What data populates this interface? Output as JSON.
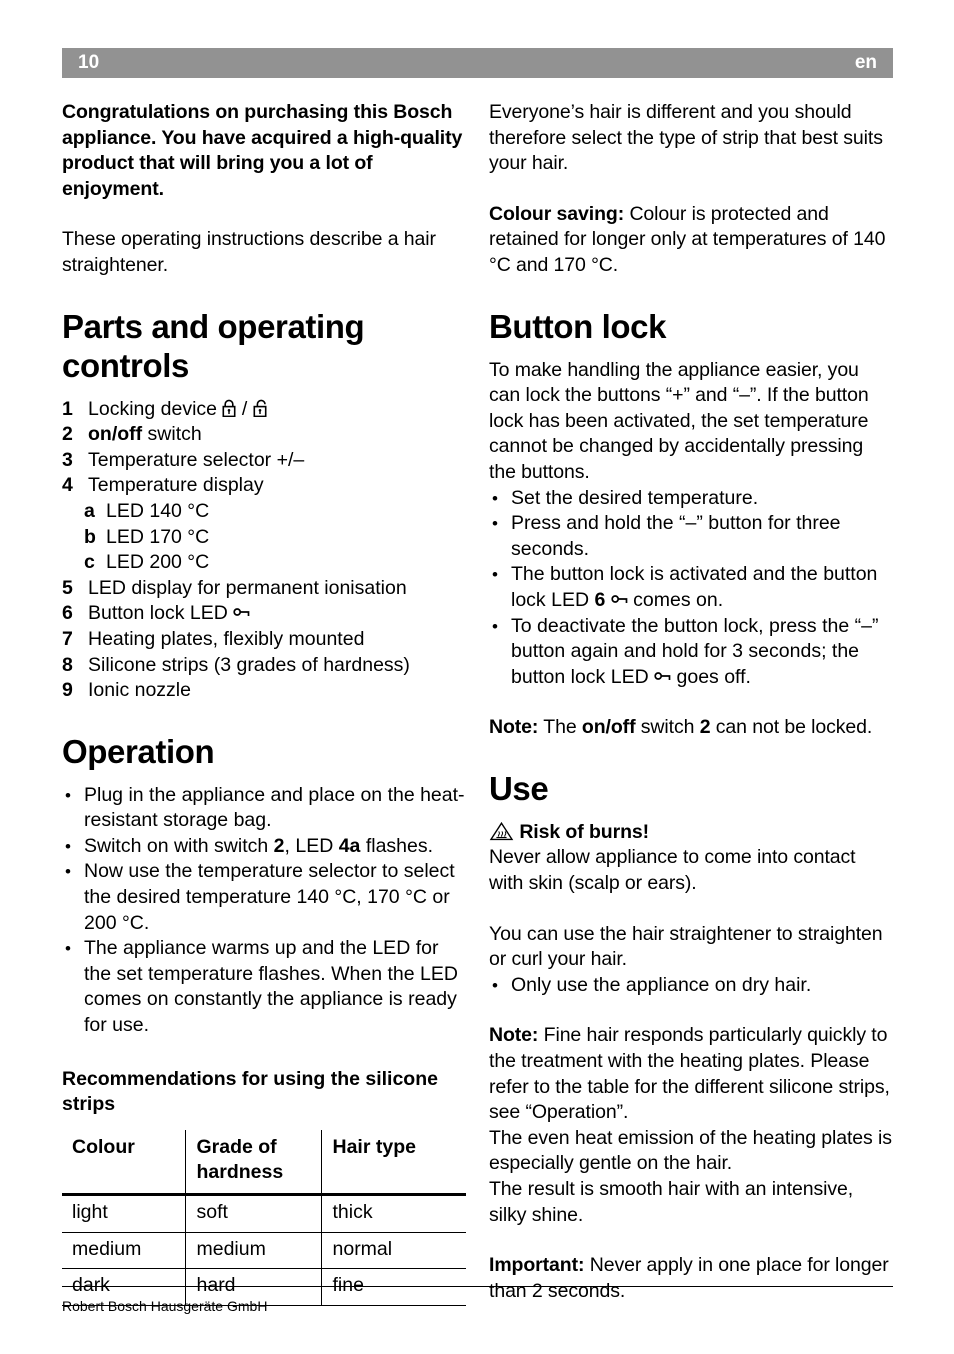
{
  "header": {
    "page_number": "10",
    "language": "en"
  },
  "left_column": {
    "intro_bold": "Congratulations on purchasing this Bosch appliance. You have acquired a high-quality product that will bring you a lot of enjoyment.",
    "intro_text": "These operating instructions describe a hair straightener.",
    "parts_heading": "Parts and operating controls",
    "parts_items": [
      {
        "num": "1",
        "text_before": "Locking device ",
        "icon": "lock-closed-open-icons",
        "text_after": ""
      },
      {
        "num": "2",
        "bold": "on/off",
        "text_after": " switch"
      },
      {
        "num": "3",
        "text_before": "Temperature selector +/–"
      },
      {
        "num": "4",
        "text_before": "Temperature display"
      },
      {
        "num": "a",
        "sub": true,
        "text_before": "LED 140 °C"
      },
      {
        "num": "b",
        "sub": true,
        "text_before": "LED 170 °C"
      },
      {
        "num": "c",
        "sub": true,
        "text_before": "LED 200 °C"
      },
      {
        "num": "5",
        "text_before": "LED display for permanent ionisation"
      },
      {
        "num": "6",
        "text_before": "Button lock LED ",
        "icon": "key-icon"
      },
      {
        "num": "7",
        "text_before": "Heating plates, flexibly mounted"
      },
      {
        "num": "8",
        "text_before": "Silicone strips (3 grades of hardness)"
      },
      {
        "num": "9",
        "text_before": "Ionic nozzle"
      }
    ],
    "operation_heading": "Operation",
    "operation_bullets": [
      "Plug in the appliance and place on the heat-resistant storage bag.",
      "Switch on with switch 2, LED 4a flashes.",
      "Now use the temperature selector to select the desired temperature 140 °C, 170 °C or 200 °C.",
      "The appliance warms up and the LED for the set temperature flashes. When the LED comes on constantly the appliance is ready for use."
    ],
    "recommendations_heading": "Recommendations for using the silicone strips",
    "table": {
      "columns": [
        "Colour",
        "Grade of hardness",
        "Hair type"
      ],
      "rows": [
        [
          "light",
          "soft",
          "thick"
        ],
        [
          "medium",
          "medium",
          "normal"
        ],
        [
          "dark",
          "hard",
          "fine"
        ]
      ]
    }
  },
  "right_column": {
    "para_everyone": "Everyone’s hair is different and you should therefore select the type of strip that best suits your hair.",
    "colour_saving_label": "Colour saving:",
    "colour_saving_text": " Colour is protected and retained for longer only at temperatures of 140 °C and 170 °C.",
    "button_lock_heading": "Button lock",
    "button_lock_intro": "To make handling the appliance easier, you can lock the buttons “+” and “–”. If the button lock has been activated, the set temperature cannot be changed by accidentally pressing the buttons.",
    "button_lock_bullets": [
      "Set the desired temperature.",
      "Press and hold the “–” button for three seconds.",
      "The button lock is activated and the button lock LED 6 ⚷ comes on.",
      "To deactivate the button lock, press the “–” button again and hold for 3 seconds; the button lock LED ⚷ goes off."
    ],
    "note_lock_label": "Note:",
    "note_lock_text_1": " The ",
    "note_lock_bold": "on/off",
    "note_lock_text_2": " switch ",
    "note_lock_bold2": "2",
    "note_lock_text_3": " can not be locked.",
    "use_heading": "Use",
    "risk_label": "Risk of burns!",
    "risk_icon": "hot-surface-warning-icon",
    "risk_text": "Never allow appliance to come into contact with skin (scalp or ears).",
    "use_para": "You can use the hair straightener to straighten or curl your hair.",
    "use_bullets": [
      "Only use the appliance on dry hair."
    ],
    "note_fine_label": "Note:",
    "note_fine_text": " Fine hair responds particularly quickly to the treatment with the heating plates. Please refer to the table for the different silicone strips, see “Operation”.",
    "note_fine_text_2": "The even heat emission of the heating plates is especially gentle on the hair.",
    "note_fine_text_3": "The result is smooth hair with an intensive, silky shine.",
    "important_label": "Important:",
    "important_text": " Never apply in one place for longer than 2 seconds."
  },
  "footer": {
    "company": "Robert Bosch Hausgeräte GmbH"
  },
  "colors": {
    "header_bar": "#929292",
    "text": "#000000",
    "header_text": "#ffffff"
  }
}
